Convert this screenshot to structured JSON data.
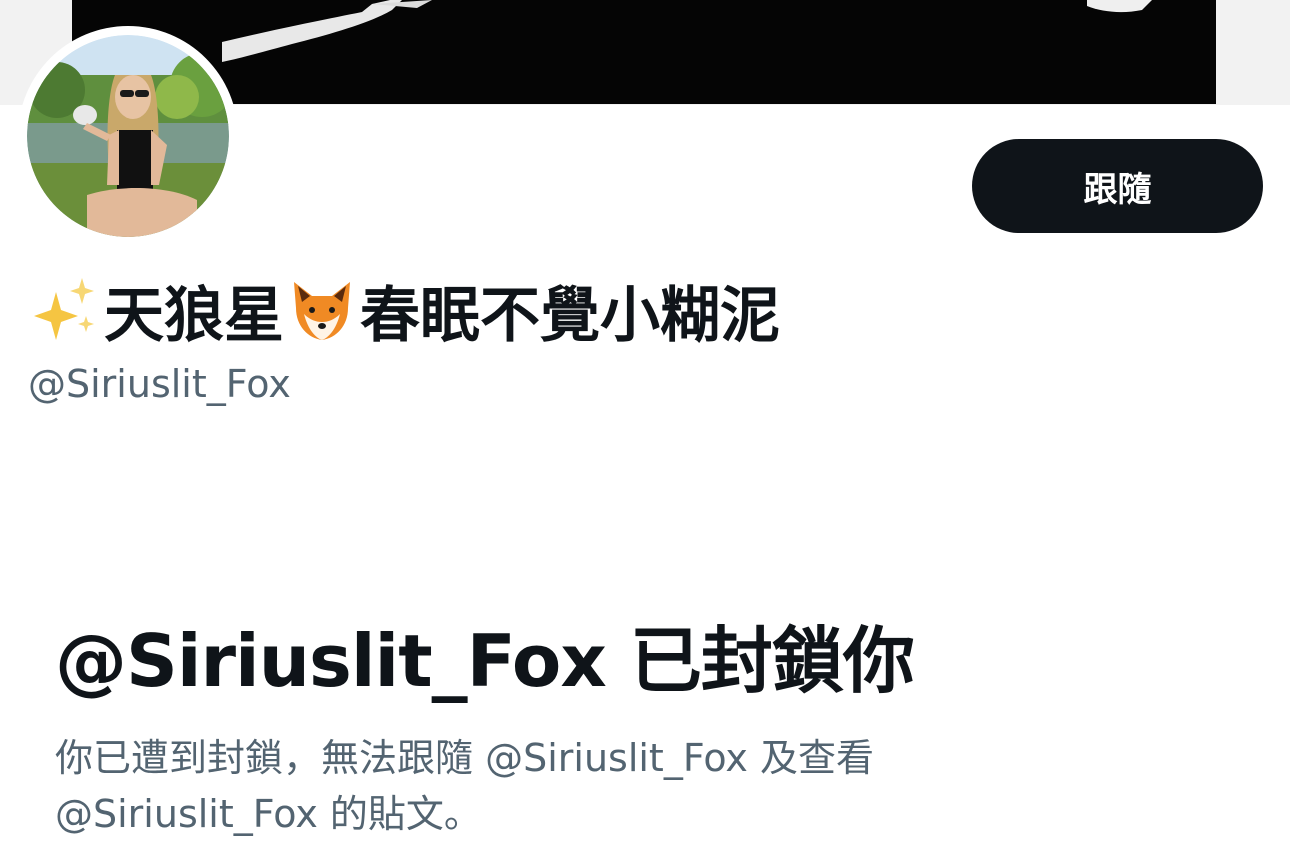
{
  "profile": {
    "display_name_part1": "天狼星",
    "display_name_part2": "春眠不覺小糊泥",
    "sparkles_icon": "sparkles-icon",
    "fox_icon": "fox-face-icon",
    "handle": "@Siriuslit_Fox",
    "follow_label": "跟隨"
  },
  "blocked": {
    "title": "@Siriuslit_Fox 已封鎖你",
    "description_line1": "你已遭到封鎖，無法跟隨 @Siriuslit_Fox 及查看",
    "description_line2": "@Siriuslit_Fox 的貼文。"
  },
  "colors": {
    "primary_text": "#0f1419",
    "secondary_text": "#536471",
    "button_bg": "#0f1419",
    "button_text": "#ffffff",
    "banner_bg": "#050505",
    "sparkle": "#f5c542",
    "fox_orange": "#f08a24"
  }
}
